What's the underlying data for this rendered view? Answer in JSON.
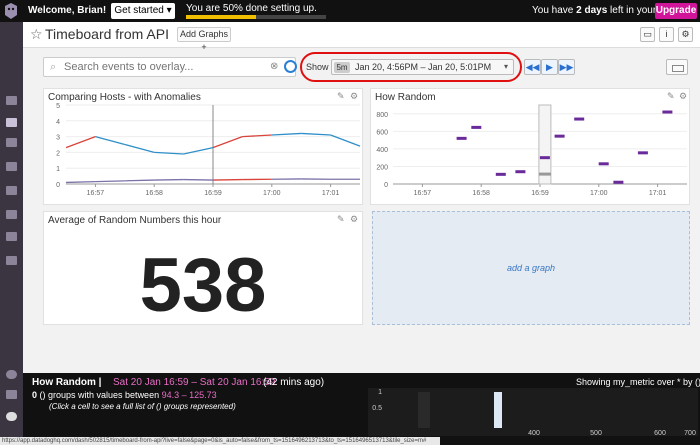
{
  "topbar": {
    "welcome": "Welcome, Brian!",
    "get_started": "Get started ▾",
    "progress_text": "You are 50% done setting up.",
    "progress_pct": 50,
    "trial_prefix": "You have ",
    "trial_days": "2 days",
    "trial_suffix": " left in your trial.",
    "upgrade": "Upgrade"
  },
  "title": {
    "text": "Timeboard from API",
    "add_graphs": "Add Graphs +"
  },
  "search": {
    "placeholder": "Search events to overlay..."
  },
  "timeframe": {
    "show_label": "Show",
    "badge": "5m",
    "range": "Jan 20, 4:56PM – Jan 20, 5:01PM"
  },
  "widgets": {
    "hosts": {
      "title": "Comparing Hosts - with Anomalies",
      "y_ticks": [
        "5",
        "4",
        "3",
        "2",
        "1",
        "0"
      ],
      "x_ticks": [
        "16:57",
        "16:58",
        "16:59",
        "17:00",
        "17:01"
      ]
    },
    "random": {
      "title": "How Random",
      "y_ticks": [
        "800",
        "600",
        "400",
        "200",
        "0"
      ],
      "x_ticks": [
        "16:57",
        "16:58",
        "16:59",
        "17:00",
        "17:01"
      ]
    },
    "average": {
      "title": "Average of Random Numbers this hour",
      "value": "538"
    },
    "add_graph": "add a graph"
  },
  "chart_data": [
    {
      "type": "line",
      "title": "Comparing Hosts - with Anomalies",
      "x": [
        "16:56:30",
        "16:57:00",
        "16:57:30",
        "16:58:00",
        "16:58:30",
        "16:59:00",
        "16:59:30",
        "17:00:00",
        "17:00:30",
        "17:01:00",
        "17:01:30"
      ],
      "series": [
        {
          "values": [
            2.3,
            3.0,
            2.5,
            2.0,
            1.9,
            2.3,
            3.0,
            3.1,
            3.2,
            3.1,
            2.4
          ]
        },
        {
          "values": [
            0.1,
            0.15,
            0.2,
            0.25,
            0.28,
            0.25,
            0.28,
            0.3,
            0.32,
            0.3,
            0.3
          ]
        }
      ],
      "ylim": [
        0,
        5
      ]
    },
    {
      "type": "scatter",
      "title": "How Random",
      "points": [
        {
          "x": "16:57:40",
          "y": 520
        },
        {
          "x": "16:57:55",
          "y": 645
        },
        {
          "x": "16:58:20",
          "y": 110
        },
        {
          "x": "16:58:40",
          "y": 140
        },
        {
          "x": "16:59:05",
          "y": 300
        },
        {
          "x": "16:59:20",
          "y": 545
        },
        {
          "x": "16:59:40",
          "y": 740
        },
        {
          "x": "17:00:05",
          "y": 230
        },
        {
          "x": "17:00:20",
          "y": 20
        },
        {
          "x": "17:00:45",
          "y": 355
        },
        {
          "x": "17:01:10",
          "y": 820
        }
      ],
      "ylim": [
        0,
        900
      ]
    }
  ],
  "bottom": {
    "title": "How Random |",
    "range": "Sat 20 Jan 16:59 – Sat 20 Jan 16:59",
    "ago": "(42 mins ago)",
    "groups_a": "0",
    "groups_b": " () groups with values between ",
    "groups_c": "94.3 – 125.73",
    "hint": "(Click a cell to see a full list of () groups represented)",
    "showing": "Showing my_metric over * by ():",
    "y_ticks": [
      "1",
      "0.5"
    ],
    "x_ticks": [
      "400",
      "500",
      "600",
      "700"
    ]
  },
  "statusbar": "https://app.datadoghq.com/dash/502815/timeboard-from-api?live=false&page=0&is_auto=false&from_ts=1516496213713&to_ts=1516496513713&tile_size=m#"
}
